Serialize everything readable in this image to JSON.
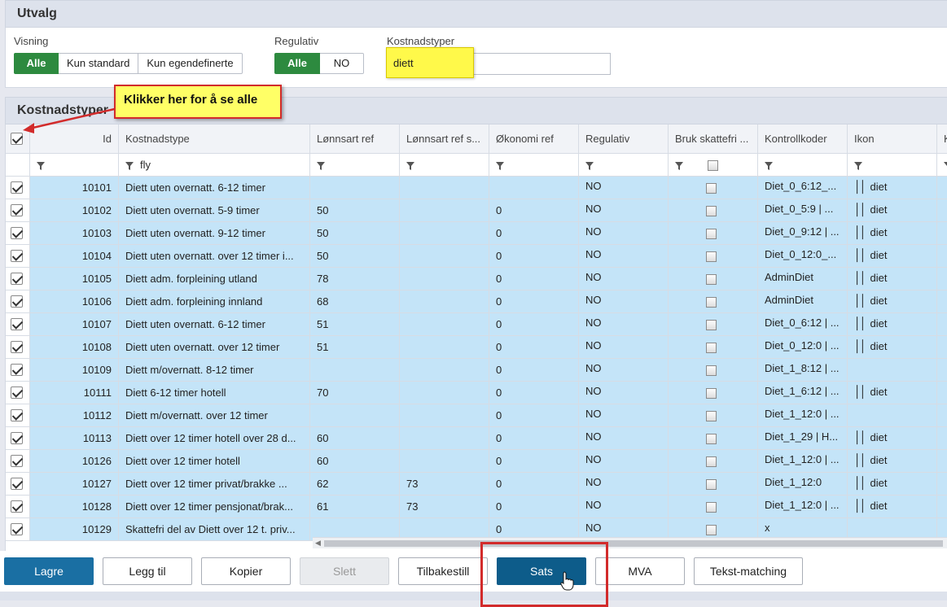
{
  "utvalg": {
    "title": "Utvalg",
    "visning": {
      "label": "Visning",
      "options": [
        "Alle",
        "Kun standard",
        "Kun egendefinerte"
      ],
      "selected": "Alle"
    },
    "regulativ": {
      "label": "Regulativ",
      "options": [
        "Alle",
        "NO"
      ],
      "selected": "Alle"
    },
    "kostnadstyper": {
      "label": "Kostnadstyper",
      "value": "diett"
    }
  },
  "grid": {
    "title": "Kostnadstyper",
    "columns": [
      "Id",
      "Kostnadstype",
      "Lønnsart ref",
      "Lønnsart ref s...",
      "Økonomi ref",
      "Regulativ",
      "Bruk skattefri ...",
      "Kontrollkoder",
      "Ikon",
      "K"
    ],
    "filter": {
      "kostnadstype": "fly"
    },
    "rows": [
      {
        "id": "10101",
        "name": "Diett uten overnatt. 6-12 timer",
        "lref": "",
        "lref2": "",
        "oko": "",
        "reg": "NO",
        "kk": "Diet_0_6:12_...",
        "ikon": "diet"
      },
      {
        "id": "10102",
        "name": "Diett uten overnatt. 5-9 timer",
        "lref": "50",
        "lref2": "",
        "oko": "0",
        "reg": "NO",
        "kk": "Diet_0_5:9 | ...",
        "ikon": "diet"
      },
      {
        "id": "10103",
        "name": "Diett uten overnatt. 9-12 timer",
        "lref": "50",
        "lref2": "",
        "oko": "0",
        "reg": "NO",
        "kk": "Diet_0_9:12 | ...",
        "ikon": "diet"
      },
      {
        "id": "10104",
        "name": "Diett uten overnatt. over 12 timer i...",
        "lref": "50",
        "lref2": "",
        "oko": "0",
        "reg": "NO",
        "kk": "Diet_0_12:0_...",
        "ikon": "diet"
      },
      {
        "id": "10105",
        "name": "Diett adm. forpleining utland",
        "lref": "78",
        "lref2": "",
        "oko": "0",
        "reg": "NO",
        "kk": "AdminDiet",
        "ikon": "diet"
      },
      {
        "id": "10106",
        "name": "Diett adm. forpleining innland",
        "lref": "68",
        "lref2": "",
        "oko": "0",
        "reg": "NO",
        "kk": "AdminDiet",
        "ikon": "diet"
      },
      {
        "id": "10107",
        "name": "Diett uten overnatt. 6-12 timer",
        "lref": "51",
        "lref2": "",
        "oko": "0",
        "reg": "NO",
        "kk": "Diet_0_6:12 | ...",
        "ikon": "diet"
      },
      {
        "id": "10108",
        "name": "Diett uten overnatt. over 12 timer",
        "lref": "51",
        "lref2": "",
        "oko": "0",
        "reg": "NO",
        "kk": "Diet_0_12:0 | ...",
        "ikon": "diet"
      },
      {
        "id": "10109",
        "name": "Diett m/overnatt. 8-12 timer",
        "lref": "",
        "lref2": "",
        "oko": "0",
        "reg": "NO",
        "kk": "Diet_1_8:12 | ...",
        "ikon": ""
      },
      {
        "id": "10111",
        "name": "Diett 6-12 timer hotell",
        "lref": "70",
        "lref2": "",
        "oko": "0",
        "reg": "NO",
        "kk": "Diet_1_6:12 | ...",
        "ikon": "diet"
      },
      {
        "id": "10112",
        "name": "Diett m/overnatt. over 12 timer",
        "lref": "",
        "lref2": "",
        "oko": "0",
        "reg": "NO",
        "kk": "Diet_1_12:0 | ...",
        "ikon": ""
      },
      {
        "id": "10113",
        "name": "Diett over 12 timer hotell over 28 d...",
        "lref": "60",
        "lref2": "",
        "oko": "0",
        "reg": "NO",
        "kk": "Diet_1_29 | H...",
        "ikon": "diet"
      },
      {
        "id": "10126",
        "name": "Diett over 12 timer hotell",
        "lref": "60",
        "lref2": "",
        "oko": "0",
        "reg": "NO",
        "kk": "Diet_1_12:0 | ...",
        "ikon": "diet"
      },
      {
        "id": "10127",
        "name": "Diett over 12 timer privat/brakke ...",
        "lref": "62",
        "lref2": "73",
        "oko": "0",
        "reg": "NO",
        "kk": "Diet_1_12:0",
        "ikon": "diet"
      },
      {
        "id": "10128",
        "name": "Diett over 12 timer pensjonat/brak...",
        "lref": "61",
        "lref2": "73",
        "oko": "0",
        "reg": "NO",
        "kk": "Diet_1_12:0 | ...",
        "ikon": "diet"
      },
      {
        "id": "10129",
        "name": "Skattefri del av Diett over 12 t. priv...",
        "lref": "",
        "lref2": "",
        "oko": "0",
        "reg": "NO",
        "kk": "x",
        "ikon": ""
      }
    ]
  },
  "buttons": {
    "lagre": "Lagre",
    "legg_til": "Legg til",
    "kopier": "Kopier",
    "slett": "Slett",
    "tilbakestill": "Tilbakestill",
    "sats": "Sats",
    "mva": "MVA",
    "tekst_matching": "Tekst-matching"
  },
  "annotation": {
    "callout": "Klikker her for å se alle"
  },
  "colors": {
    "active_green": "#2d8a3f",
    "row_blue": "#c4e4f8",
    "primary_blue": "#1a6fa3",
    "annotation_red": "#d22b2b",
    "highlight_yellow": "#ffff66"
  }
}
